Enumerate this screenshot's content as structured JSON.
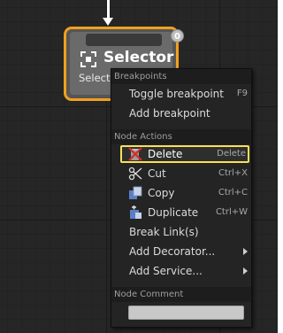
{
  "node": {
    "title": "Selector",
    "subtitle": "Selector",
    "badge": "0",
    "icon": "selector-icon",
    "border_color": "#f2a01e"
  },
  "menu": {
    "sections": {
      "breakpoints": {
        "header": "Breakpoints",
        "items": [
          {
            "label": "Toggle breakpoint",
            "shortcut": "F9"
          },
          {
            "label": "Add breakpoint",
            "shortcut": ""
          }
        ]
      },
      "node_actions": {
        "header": "Node Actions",
        "items": [
          {
            "label": "Delete",
            "shortcut": "Delete",
            "icon": "delete-icon",
            "selected": true
          },
          {
            "label": "Cut",
            "shortcut": "Ctrl+X",
            "icon": "scissors-icon"
          },
          {
            "label": "Copy",
            "shortcut": "Ctrl+C",
            "icon": "copy-icon"
          },
          {
            "label": "Duplicate",
            "shortcut": "Ctrl+W",
            "icon": "duplicate-icon"
          },
          {
            "label": "Break Link(s)",
            "shortcut": ""
          },
          {
            "label": "Add Decorator...",
            "submenu": true
          },
          {
            "label": "Add Service...",
            "submenu": true
          }
        ]
      },
      "node_comment": {
        "header": "Node Comment",
        "value": ""
      }
    }
  },
  "colors": {
    "highlight": "#f7e15a",
    "menu_bg": "#242424",
    "canvas_bg": "#262626"
  }
}
